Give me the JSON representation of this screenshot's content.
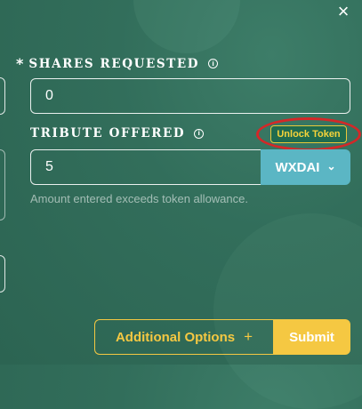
{
  "modal": {
    "close_icon": "×"
  },
  "shares": {
    "required_mark": "*",
    "label": "SHARES REQUESTED",
    "info_icon": "i",
    "value": "0"
  },
  "tribute": {
    "label": "TRIBUTE OFFERED",
    "info_icon": "i",
    "value": "5",
    "token": "WXDAI",
    "chevron_icon": "⌄",
    "unlock_label": "Unlock Token",
    "helper_text": "Amount entered exceeds token allowance."
  },
  "actions": {
    "additional_options_label": "Additional Options",
    "plus_icon": "+",
    "submit_label": "Submit"
  },
  "colors": {
    "background": "#326e5b",
    "accent_yellow": "#f5c842",
    "token_select": "#5bb6c4",
    "highlight_circle": "#d42828"
  }
}
